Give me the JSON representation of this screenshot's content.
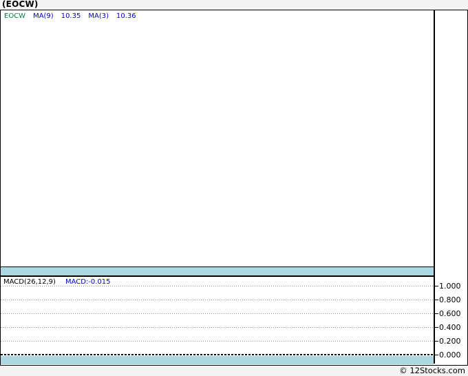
{
  "window": {
    "title": "(EOCW)"
  },
  "main_chart": {
    "legend": {
      "symbol": "EOCW",
      "ma9_label": "MA(9)",
      "ma9_value": "10.35",
      "ma3_label": "MA(3)",
      "ma3_value": "10.36"
    }
  },
  "macd_chart": {
    "legend_label": "MACD(26,12,9)",
    "legend_value": "MACD:-0.015",
    "axis_labels": [
      "1.000",
      "0.800",
      "0.600",
      "0.400",
      "0.200",
      "0.000"
    ]
  },
  "footer": {
    "copyright": "© 12Stocks.com"
  },
  "colors": {
    "page_background": "#f4f4f4",
    "panel_background": "#ffffff",
    "separator_band": "#acd8e4",
    "border": "#000000",
    "gridline": "#888888",
    "zero_line": "#000000",
    "symbol_green": "#008040",
    "indicator_blue": "#0000cc"
  },
  "chart_data": [
    {
      "type": "line",
      "title": "(EOCW) price panel",
      "series": [
        {
          "name": "EOCW",
          "color": "#008040",
          "values": []
        },
        {
          "name": "MA(9)",
          "color": "#0000cc",
          "last_value": 10.35,
          "values": []
        },
        {
          "name": "MA(3)",
          "color": "#0000cc",
          "last_value": 10.36,
          "values": []
        }
      ],
      "note_visible_content": "plot area is empty (no visible price data)",
      "legend_position": "top-left",
      "grid": false
    },
    {
      "type": "line",
      "title": "MACD(26,12,9)",
      "series": [
        {
          "name": "MACD",
          "last_value": -0.015,
          "values": []
        }
      ],
      "ylabel": "",
      "yticks": [
        1.0,
        0.8,
        0.6,
        0.4,
        0.2,
        0.0
      ],
      "ytick_labels": [
        "1.000",
        "0.800",
        "0.600",
        "0.400",
        "0.200",
        "0.000"
      ],
      "ylim": [
        -0.13,
        1.13
      ],
      "grid": true,
      "legend_position": "top-left",
      "axis_side": "right"
    }
  ]
}
